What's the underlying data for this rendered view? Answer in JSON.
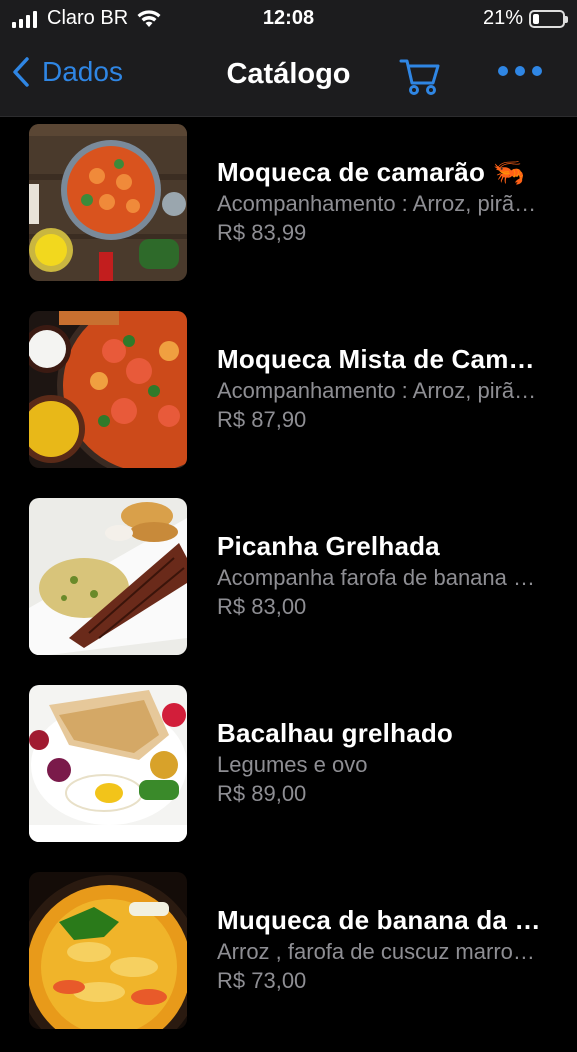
{
  "status_bar": {
    "carrier": "Claro BR",
    "time": "12:08",
    "battery": "21%",
    "battery_level": 0.21
  },
  "nav": {
    "back_label": "Dados",
    "title": "Catálogo",
    "cart_icon": "cart-icon",
    "more_icon": "more-icon",
    "accent_color": "#2f86e4"
  },
  "products": [
    {
      "name": "Moqueca de camarão 🦐",
      "description": "Acompanhamento : Arroz, pirão e farofa",
      "price": "R$ 83,99"
    },
    {
      "name": "Moqueca Mista de Camarão e Peixe",
      "description": "Acompanhamento : Arroz, pirão e farofa",
      "price": "R$ 87,90"
    },
    {
      "name": "Picanha Grelhada",
      "description": "Acompanha farofa de banana e arroz",
      "price": "R$ 83,00"
    },
    {
      "name": "Bacalhau grelhado",
      "description": "Legumes e ovo",
      "price": "R$ 89,00"
    },
    {
      "name": "Muqueca de banana da terra",
      "description": "Arroz , farofa de cuscuz marroquino",
      "price": "R$ 73,00"
    }
  ]
}
